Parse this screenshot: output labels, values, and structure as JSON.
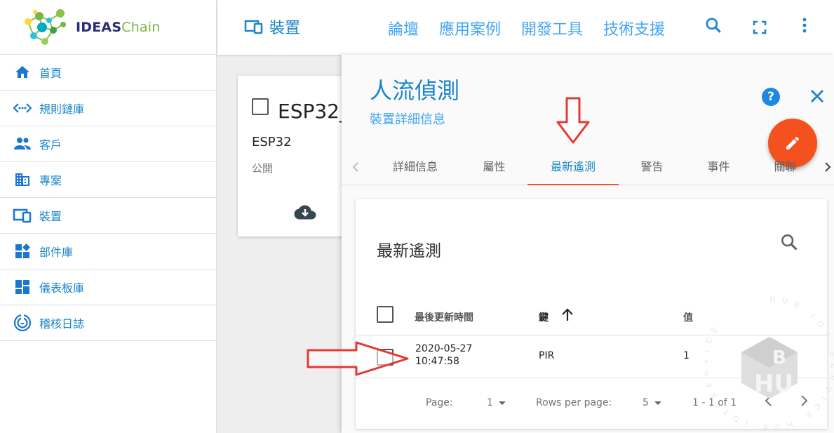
{
  "logo": {
    "text_a": "IDEAS",
    "text_b": "Chain"
  },
  "sidebar": {
    "items": [
      {
        "label": "首頁",
        "icon": "home-icon"
      },
      {
        "label": "規則鏈庫",
        "icon": "rule-chain-icon"
      },
      {
        "label": "客戶",
        "icon": "customers-icon"
      },
      {
        "label": "專案",
        "icon": "assets-icon"
      },
      {
        "label": "裝置",
        "icon": "devices-icon"
      },
      {
        "label": "部件庫",
        "icon": "widgets-icon"
      },
      {
        "label": "儀表板庫",
        "icon": "dashboard-icon"
      },
      {
        "label": "稽核日誌",
        "icon": "audit-log-icon"
      }
    ]
  },
  "topbar": {
    "breadcrumb": "裝置",
    "links": [
      "論壇",
      "應用案例",
      "開發工具",
      "技術支援"
    ]
  },
  "device_card": {
    "title": "ESP32_",
    "type": "ESP32",
    "visibility": "公開"
  },
  "panel": {
    "title": "人流偵測",
    "subtitle": "裝置詳細信息",
    "help": "?",
    "tabs": [
      "詳細信息",
      "屬性",
      "最新遙測",
      "警告",
      "事件",
      "關聯"
    ],
    "active_tab": "最新遙測"
  },
  "telemetry": {
    "title": "最新遙測",
    "columns": [
      "最後更新時間",
      "鍵",
      "值"
    ],
    "rows": [
      {
        "date": "2020-05-27",
        "time": "10:47:58",
        "key": "PIR",
        "value": "1"
      }
    ],
    "footer": {
      "page_label": "Page:",
      "page_value": "1",
      "rows_label": "Rows per page:",
      "rows_value": "5",
      "range": "1 - 1 of 1"
    }
  },
  "watermark": {
    "text": "HUB IOT SERVICE HUB IOT SERVICE"
  },
  "colors": {
    "accent": "#1a85c8",
    "fab": "#f4511e",
    "arrow": "#e53935"
  }
}
